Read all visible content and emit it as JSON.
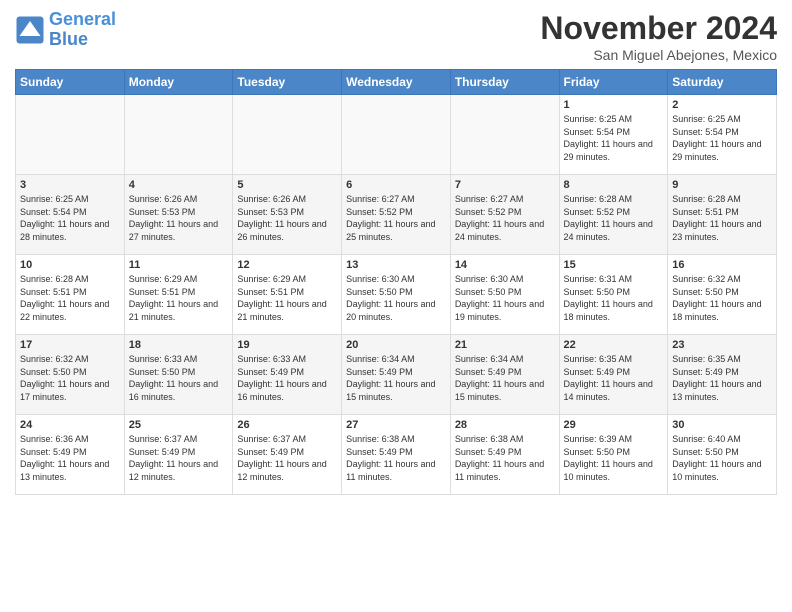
{
  "header": {
    "logo_line1": "General",
    "logo_line2": "Blue",
    "month": "November 2024",
    "location": "San Miguel Abejones, Mexico"
  },
  "weekdays": [
    "Sunday",
    "Monday",
    "Tuesday",
    "Wednesday",
    "Thursday",
    "Friday",
    "Saturday"
  ],
  "weeks": [
    [
      {
        "day": "",
        "info": ""
      },
      {
        "day": "",
        "info": ""
      },
      {
        "day": "",
        "info": ""
      },
      {
        "day": "",
        "info": ""
      },
      {
        "day": "",
        "info": ""
      },
      {
        "day": "1",
        "info": "Sunrise: 6:25 AM\nSunset: 5:54 PM\nDaylight: 11 hours and 29 minutes."
      },
      {
        "day": "2",
        "info": "Sunrise: 6:25 AM\nSunset: 5:54 PM\nDaylight: 11 hours and 29 minutes."
      }
    ],
    [
      {
        "day": "3",
        "info": "Sunrise: 6:25 AM\nSunset: 5:54 PM\nDaylight: 11 hours and 28 minutes."
      },
      {
        "day": "4",
        "info": "Sunrise: 6:26 AM\nSunset: 5:53 PM\nDaylight: 11 hours and 27 minutes."
      },
      {
        "day": "5",
        "info": "Sunrise: 6:26 AM\nSunset: 5:53 PM\nDaylight: 11 hours and 26 minutes."
      },
      {
        "day": "6",
        "info": "Sunrise: 6:27 AM\nSunset: 5:52 PM\nDaylight: 11 hours and 25 minutes."
      },
      {
        "day": "7",
        "info": "Sunrise: 6:27 AM\nSunset: 5:52 PM\nDaylight: 11 hours and 24 minutes."
      },
      {
        "day": "8",
        "info": "Sunrise: 6:28 AM\nSunset: 5:52 PM\nDaylight: 11 hours and 24 minutes."
      },
      {
        "day": "9",
        "info": "Sunrise: 6:28 AM\nSunset: 5:51 PM\nDaylight: 11 hours and 23 minutes."
      }
    ],
    [
      {
        "day": "10",
        "info": "Sunrise: 6:28 AM\nSunset: 5:51 PM\nDaylight: 11 hours and 22 minutes."
      },
      {
        "day": "11",
        "info": "Sunrise: 6:29 AM\nSunset: 5:51 PM\nDaylight: 11 hours and 21 minutes."
      },
      {
        "day": "12",
        "info": "Sunrise: 6:29 AM\nSunset: 5:51 PM\nDaylight: 11 hours and 21 minutes."
      },
      {
        "day": "13",
        "info": "Sunrise: 6:30 AM\nSunset: 5:50 PM\nDaylight: 11 hours and 20 minutes."
      },
      {
        "day": "14",
        "info": "Sunrise: 6:30 AM\nSunset: 5:50 PM\nDaylight: 11 hours and 19 minutes."
      },
      {
        "day": "15",
        "info": "Sunrise: 6:31 AM\nSunset: 5:50 PM\nDaylight: 11 hours and 18 minutes."
      },
      {
        "day": "16",
        "info": "Sunrise: 6:32 AM\nSunset: 5:50 PM\nDaylight: 11 hours and 18 minutes."
      }
    ],
    [
      {
        "day": "17",
        "info": "Sunrise: 6:32 AM\nSunset: 5:50 PM\nDaylight: 11 hours and 17 minutes."
      },
      {
        "day": "18",
        "info": "Sunrise: 6:33 AM\nSunset: 5:50 PM\nDaylight: 11 hours and 16 minutes."
      },
      {
        "day": "19",
        "info": "Sunrise: 6:33 AM\nSunset: 5:49 PM\nDaylight: 11 hours and 16 minutes."
      },
      {
        "day": "20",
        "info": "Sunrise: 6:34 AM\nSunset: 5:49 PM\nDaylight: 11 hours and 15 minutes."
      },
      {
        "day": "21",
        "info": "Sunrise: 6:34 AM\nSunset: 5:49 PM\nDaylight: 11 hours and 15 minutes."
      },
      {
        "day": "22",
        "info": "Sunrise: 6:35 AM\nSunset: 5:49 PM\nDaylight: 11 hours and 14 minutes."
      },
      {
        "day": "23",
        "info": "Sunrise: 6:35 AM\nSunset: 5:49 PM\nDaylight: 11 hours and 13 minutes."
      }
    ],
    [
      {
        "day": "24",
        "info": "Sunrise: 6:36 AM\nSunset: 5:49 PM\nDaylight: 11 hours and 13 minutes."
      },
      {
        "day": "25",
        "info": "Sunrise: 6:37 AM\nSunset: 5:49 PM\nDaylight: 11 hours and 12 minutes."
      },
      {
        "day": "26",
        "info": "Sunrise: 6:37 AM\nSunset: 5:49 PM\nDaylight: 11 hours and 12 minutes."
      },
      {
        "day": "27",
        "info": "Sunrise: 6:38 AM\nSunset: 5:49 PM\nDaylight: 11 hours and 11 minutes."
      },
      {
        "day": "28",
        "info": "Sunrise: 6:38 AM\nSunset: 5:49 PM\nDaylight: 11 hours and 11 minutes."
      },
      {
        "day": "29",
        "info": "Sunrise: 6:39 AM\nSunset: 5:50 PM\nDaylight: 11 hours and 10 minutes."
      },
      {
        "day": "30",
        "info": "Sunrise: 6:40 AM\nSunset: 5:50 PM\nDaylight: 11 hours and 10 minutes."
      }
    ]
  ]
}
